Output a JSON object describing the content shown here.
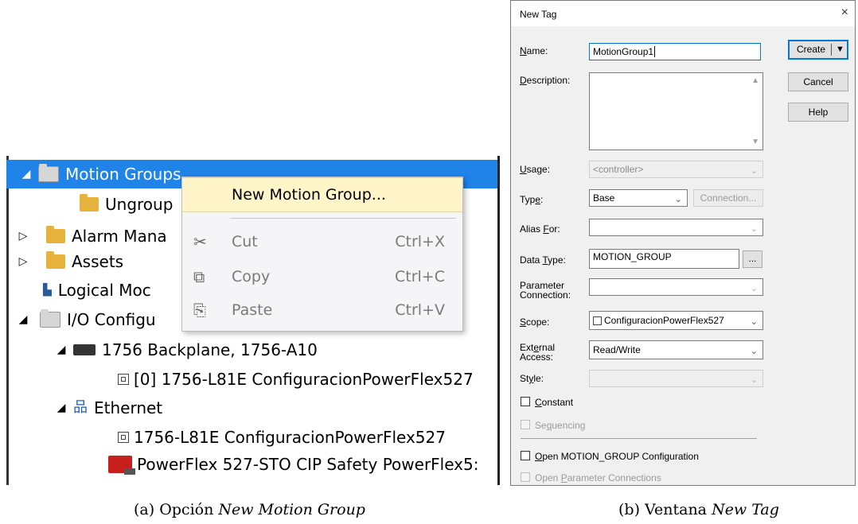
{
  "tree": {
    "items": [
      {
        "label": "Motion Groups",
        "toggle": "◢"
      },
      {
        "label": "Ungroup"
      },
      {
        "label": "Alarm Mana",
        "toggle": "▷"
      },
      {
        "label": "Assets",
        "toggle": "▷"
      },
      {
        "label": "Logical Moc"
      },
      {
        "label": "I/O Configu",
        "toggle": "◢"
      },
      {
        "label": "1756 Backplane, 1756-A10",
        "toggle": "◢"
      },
      {
        "label": "[0] 1756-L81E ConfiguracionPowerFlex527"
      },
      {
        "label": "Ethernet",
        "toggle": "◢"
      },
      {
        "label": "1756-L81E ConfiguracionPowerFlex527"
      },
      {
        "label": "PowerFlex 527-STO CIP Safety PowerFlex5:"
      }
    ]
  },
  "context_menu": {
    "items": [
      {
        "label": "New Motion Group...",
        "shortcut": ""
      },
      {
        "label": "Cut",
        "shortcut": "Ctrl+X",
        "icon": "✂"
      },
      {
        "label": "Copy",
        "shortcut": "Ctrl+C",
        "icon": "⧉"
      },
      {
        "label": "Paste",
        "shortcut": "Ctrl+V",
        "icon": "📋"
      }
    ]
  },
  "captions": {
    "a_prefix": "(a) Opción",
    "a_italic": "New Motion Group",
    "b_prefix": "(b) Ventana",
    "b_italic": "New Tag"
  },
  "dialog": {
    "title": "New Tag",
    "close": "×",
    "labels": {
      "name": "Name:",
      "description": "Description:",
      "usage": "Usage:",
      "type": "Type:",
      "alias_for": "Alias For:",
      "data_type": "Data Type:",
      "parameter_connection_1": "Parameter",
      "parameter_connection_2": "Connection:",
      "scope": "Scope:",
      "external_access_1": "External",
      "external_access_2": "Access:",
      "style": "Style:"
    },
    "values": {
      "name": "MotionGroup1",
      "description": "",
      "usage": "<controller>",
      "type": "Base",
      "alias_for": "",
      "data_type": "MOTION_GROUP",
      "parameter_connection": "",
      "scope": "ConfiguracionPowerFlex527",
      "external_access": "Read/Write",
      "style": ""
    },
    "buttons": {
      "create": "Create",
      "cancel": "Cancel",
      "help": "Help",
      "connection": "Connection...",
      "browse": "..."
    },
    "checkboxes": {
      "constant": "Constant",
      "sequencing": "Sequencing",
      "open_config": "Open MOTION_GROUP Configuration",
      "open_params": "Open Parameter Connections"
    }
  }
}
